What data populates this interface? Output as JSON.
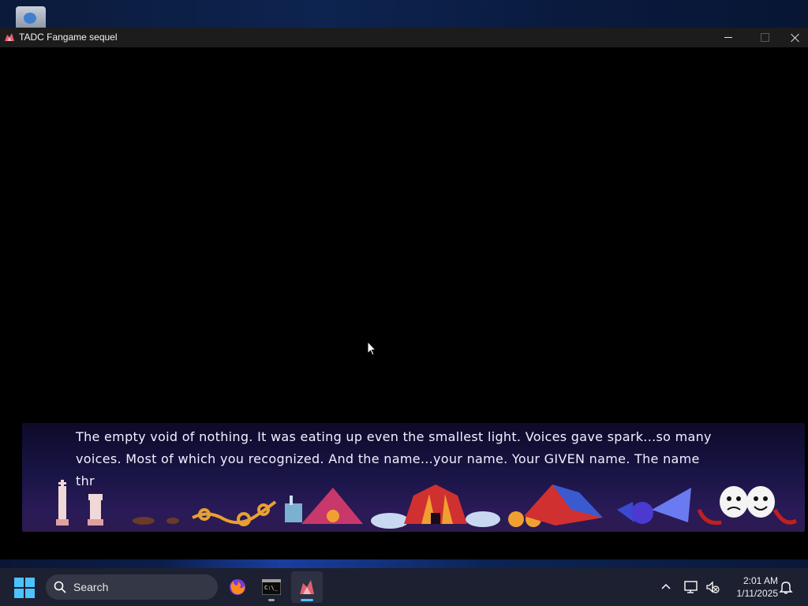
{
  "window": {
    "title": "TADC Fangame sequel"
  },
  "dialogue": {
    "line1": "The empty void of nothing. It was eating up even the smallest light. Voices gave spark...so many",
    "line2": "voices. Most of which you recognized. And the name...your name. Your GIVEN name. The name",
    "line3": "thr"
  },
  "taskbar": {
    "search_label": "Search",
    "apps": [
      {
        "name": "firefox",
        "icon": "firefox-icon"
      },
      {
        "name": "terminal",
        "icon": "terminal-icon"
      },
      {
        "name": "tadc-fangame",
        "icon": "game-icon",
        "active": true
      }
    ],
    "time": "2:01 AM",
    "date": "1/11/2025"
  },
  "colors": {
    "accent": "#4cc2ff",
    "dialog_bg": "#1b1546",
    "taskbar_bg": "#1d2030"
  }
}
